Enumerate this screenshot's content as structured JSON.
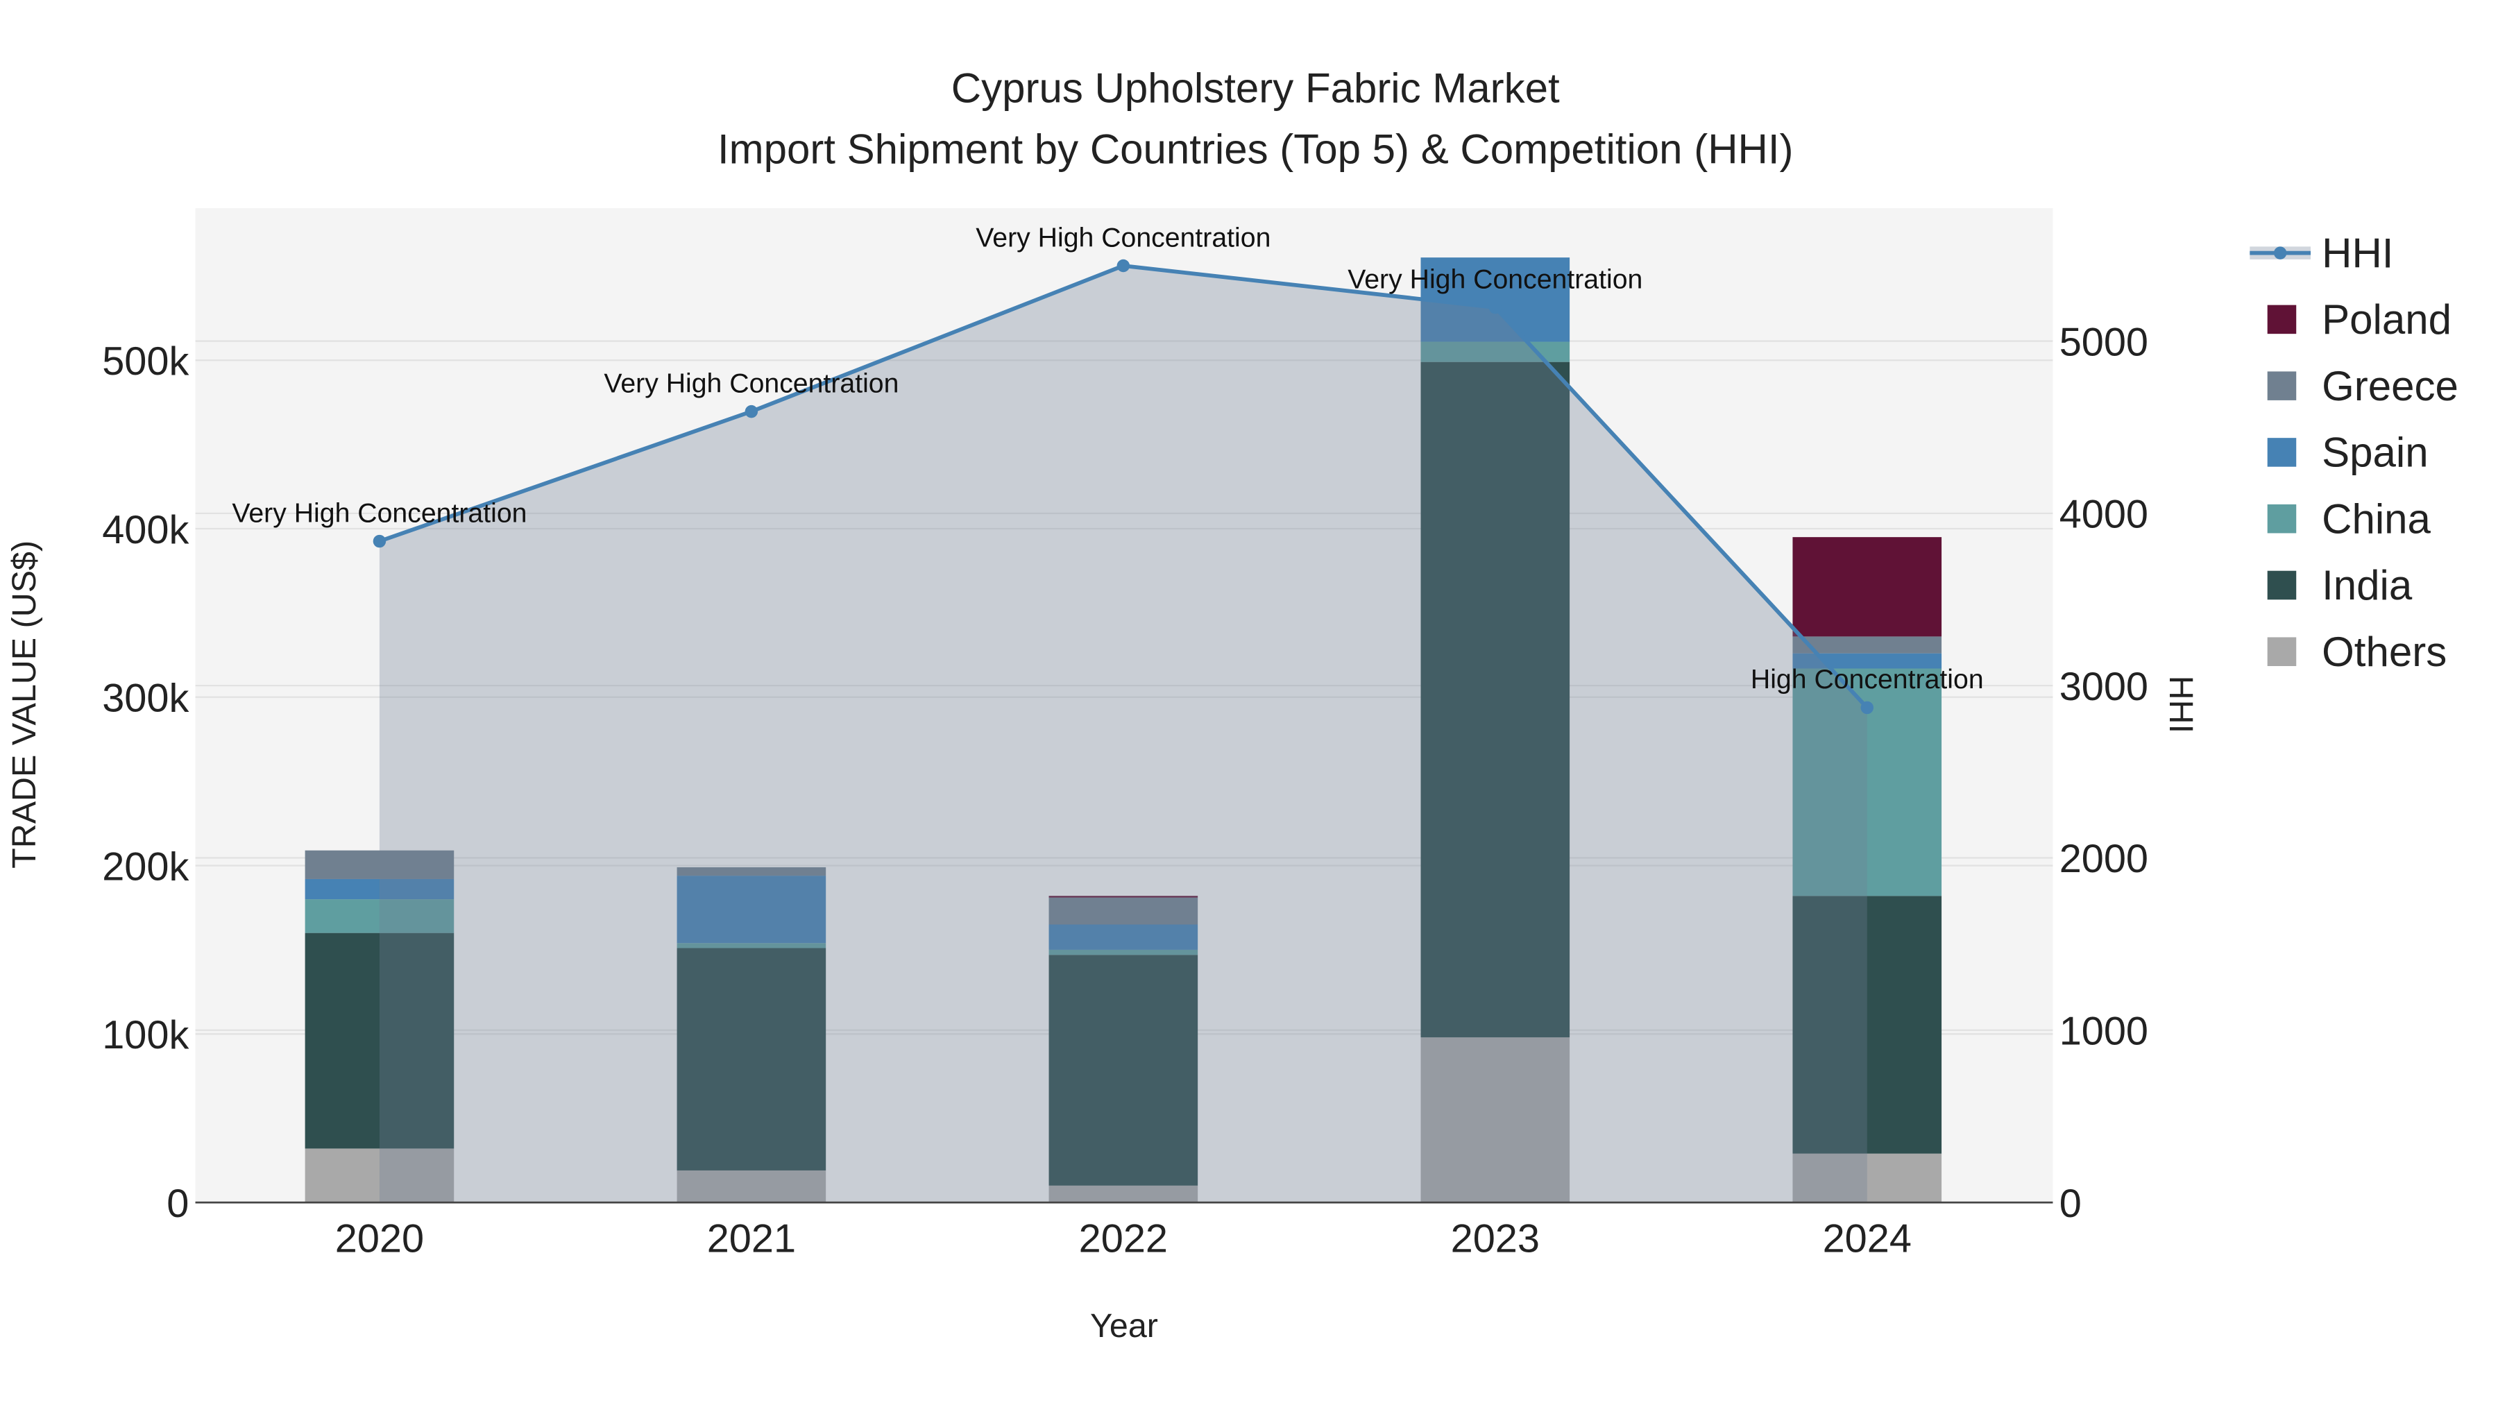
{
  "chart_data": {
    "type": "bar",
    "title": "Cyprus Upholstery Fabric Market",
    "subtitle": "Import Shipment by Countries (Top 5) & Competition (HHI)",
    "xlabel": "Year",
    "ylabel": "TRADE VALUE (US$)",
    "y2label": "HHI",
    "categories": [
      "2020",
      "2021",
      "2022",
      "2023",
      "2024"
    ],
    "ylim": [
      0,
      590000
    ],
    "y2lim": [
      0,
      5770
    ],
    "yticks": [
      0,
      100000,
      200000,
      300000,
      400000,
      500000
    ],
    "ytick_labels": [
      "0",
      "100k",
      "200k",
      "300k",
      "400k",
      "500k"
    ],
    "y2ticks": [
      0,
      1000,
      2000,
      3000,
      4000,
      5000
    ],
    "y2tick_labels": [
      "0",
      "1000",
      "2000",
      "3000",
      "4000",
      "5000"
    ],
    "grid": true,
    "legend_placement": "right",
    "series": [
      {
        "name": "Others",
        "color": "#a9a9a9",
        "values": [
          32000,
          19000,
          10000,
          98000,
          29000
        ]
      },
      {
        "name": "India",
        "color": "#2f4f4f",
        "values": [
          128000,
          132000,
          137000,
          401000,
          153000
        ]
      },
      {
        "name": "China",
        "color": "#5f9ea0",
        "values": [
          20000,
          3000,
          3000,
          12000,
          135000
        ]
      },
      {
        "name": "Spain",
        "color": "#4682b4",
        "values": [
          12000,
          40000,
          15000,
          50000,
          9000
        ]
      },
      {
        "name": "Greece",
        "color": "#708090",
        "values": [
          17000,
          5000,
          16000,
          0,
          10000
        ]
      },
      {
        "name": "Poland",
        "color": "#601236",
        "values": [
          0,
          0,
          1000,
          0,
          59000
        ]
      }
    ],
    "hhi": {
      "name": "HHI",
      "color": "#4682b4",
      "values": [
        3838,
        4591,
        5437,
        5195,
        2872
      ],
      "annotations": [
        "Very High Concentration",
        "Very High Concentration",
        "Very High Concentration",
        "Very High Concentration",
        "High Concentration"
      ]
    },
    "legend_order": [
      "HHI",
      "Poland",
      "Greece",
      "Spain",
      "China",
      "India",
      "Others"
    ]
  }
}
